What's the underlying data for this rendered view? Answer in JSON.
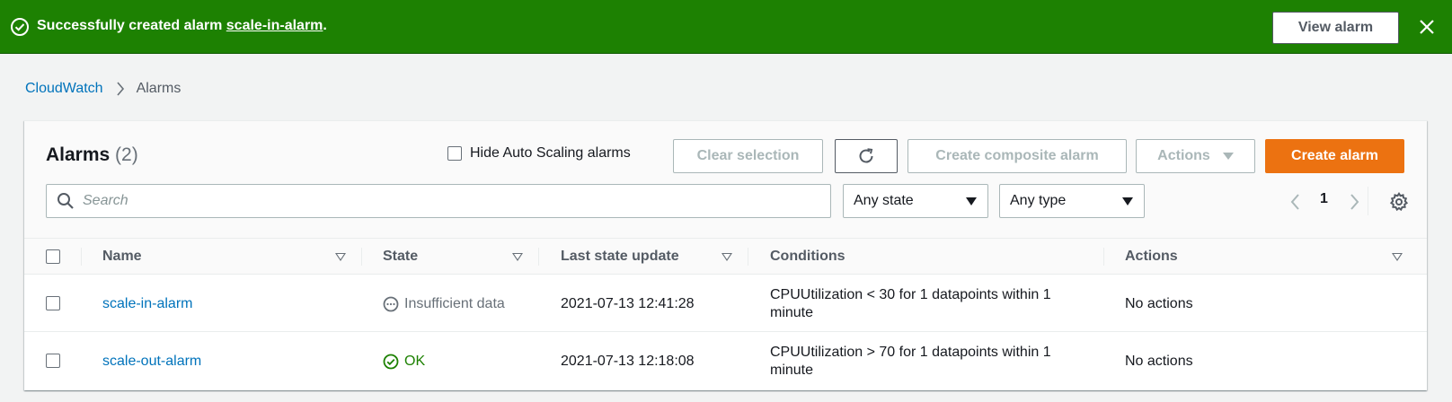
{
  "flash": {
    "prefix": "Successfully created alarm ",
    "alarm_link": "scale-in-alarm",
    "suffix": ".",
    "view_button": "View alarm",
    "color": "#1d8102"
  },
  "breadcrumb": {
    "root": "CloudWatch",
    "current": "Alarms"
  },
  "alarms_panel": {
    "title": "Alarms",
    "count": "(2)",
    "hide_autoscaling_label": "Hide Auto Scaling alarms",
    "hide_autoscaling_checked": false,
    "clear_selection": "Clear selection",
    "create_composite": "Create composite alarm",
    "actions": "Actions",
    "create_alarm": "Create alarm",
    "create_alarm_color": "#ec7211",
    "search_placeholder": "Search",
    "state_filter": "Any state",
    "type_filter": "Any type",
    "page": "1"
  },
  "table": {
    "columns": [
      "Name",
      "State",
      "Last state update",
      "Conditions",
      "Actions"
    ],
    "rows": [
      {
        "name": "scale-in-alarm",
        "state": "Insufficient data",
        "state_icon": "ellipsis-circle-icon",
        "last_update": "2021-07-13 12:41:28",
        "conditions": "CPUUtilization < 30 for 1 datapoints within 1 minute",
        "actions": "No actions"
      },
      {
        "name": "scale-out-alarm",
        "state": "OK",
        "state_icon": "check-circle-icon",
        "last_update": "2021-07-13 12:18:08",
        "conditions": "CPUUtilization > 70 for 1 datapoints within 1 minute",
        "actions": "No actions"
      }
    ]
  }
}
